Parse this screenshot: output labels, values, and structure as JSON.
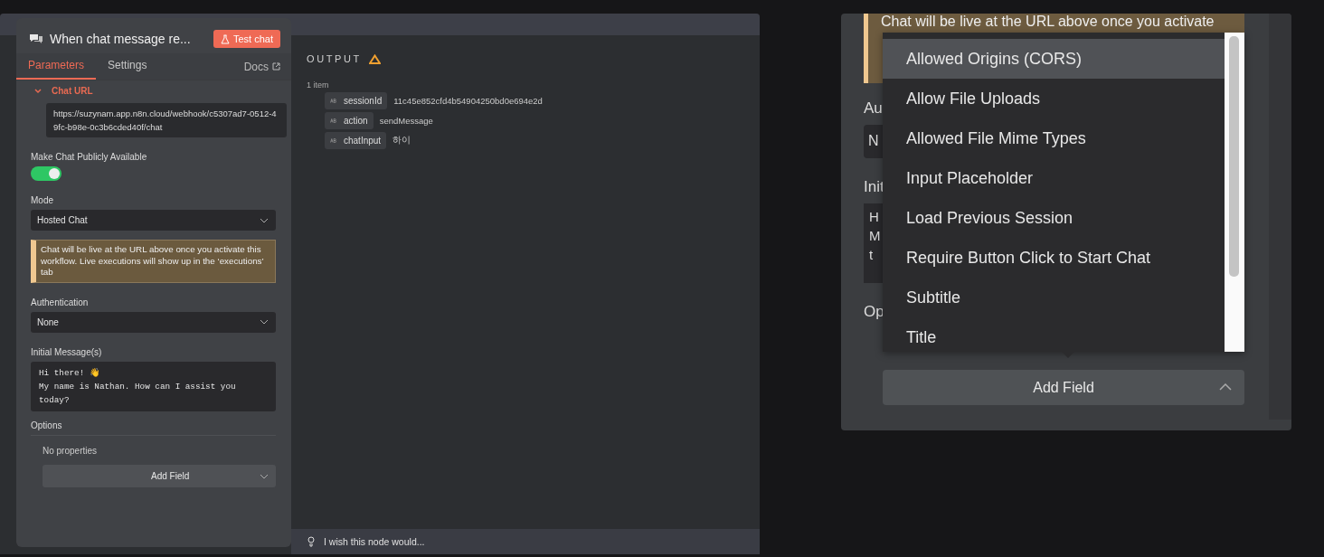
{
  "node_panel": {
    "title": "When chat message re...",
    "test_button": "Test chat",
    "tabs": [
      {
        "label": "Parameters",
        "selected": true
      },
      {
        "label": "Settings",
        "selected": false
      }
    ],
    "docs_link": "Docs",
    "chat_url": {
      "label": "Chat URL",
      "expanded": true,
      "value": "https://suzynam.app.n8n.cloud/webhook/c5307ad7-0512-49fc-b98e-0c3b6cded40f/chat"
    },
    "public_toggle": {
      "label": "Make Chat Publicly Available",
      "on": true
    },
    "mode": {
      "label": "Mode",
      "value": "Hosted Chat"
    },
    "notice": "Chat will be live at the URL above once you activate this workflow. Live executions will show up in the ‘executions’ tab",
    "authentication": {
      "label": "Authentication",
      "value": "None"
    },
    "initial_messages": {
      "label": "Initial Message(s)",
      "value": "Hi there! 👋\nMy name is Nathan. How can I assist you today?"
    },
    "options": {
      "label": "Options",
      "empty_text": "No properties",
      "add_button": "Add Field"
    }
  },
  "output": {
    "title": "OUTPUT",
    "count": "1 item",
    "fields": [
      {
        "name": "sessionId",
        "value": "11c45e852cfd4b54904250bd0e694e2d"
      },
      {
        "name": "action",
        "value": "sendMessage"
      },
      {
        "name": "chatInput",
        "value": "하이"
      }
    ]
  },
  "feedback": {
    "placeholder": "I wish this node would..."
  },
  "zoomed_view": {
    "notice": "Chat will be live at the URL above once you activate",
    "auth_label": "Au",
    "auth_value": "N",
    "messages_label": "Init",
    "message_lines": [
      "H",
      "M",
      "t"
    ],
    "options_label": "Op",
    "dropdown": [
      {
        "label": "Allowed Origins (CORS)",
        "selected": true
      },
      {
        "label": "Allow File Uploads",
        "selected": false
      },
      {
        "label": "Allowed File Mime Types",
        "selected": false
      },
      {
        "label": "Input Placeholder",
        "selected": false
      },
      {
        "label": "Load Previous Session",
        "selected": false
      },
      {
        "label": "Require Button Click to Start Chat",
        "selected": false
      },
      {
        "label": "Subtitle",
        "selected": false
      },
      {
        "label": "Title",
        "selected": false
      }
    ],
    "add_button": "Add Field"
  }
}
